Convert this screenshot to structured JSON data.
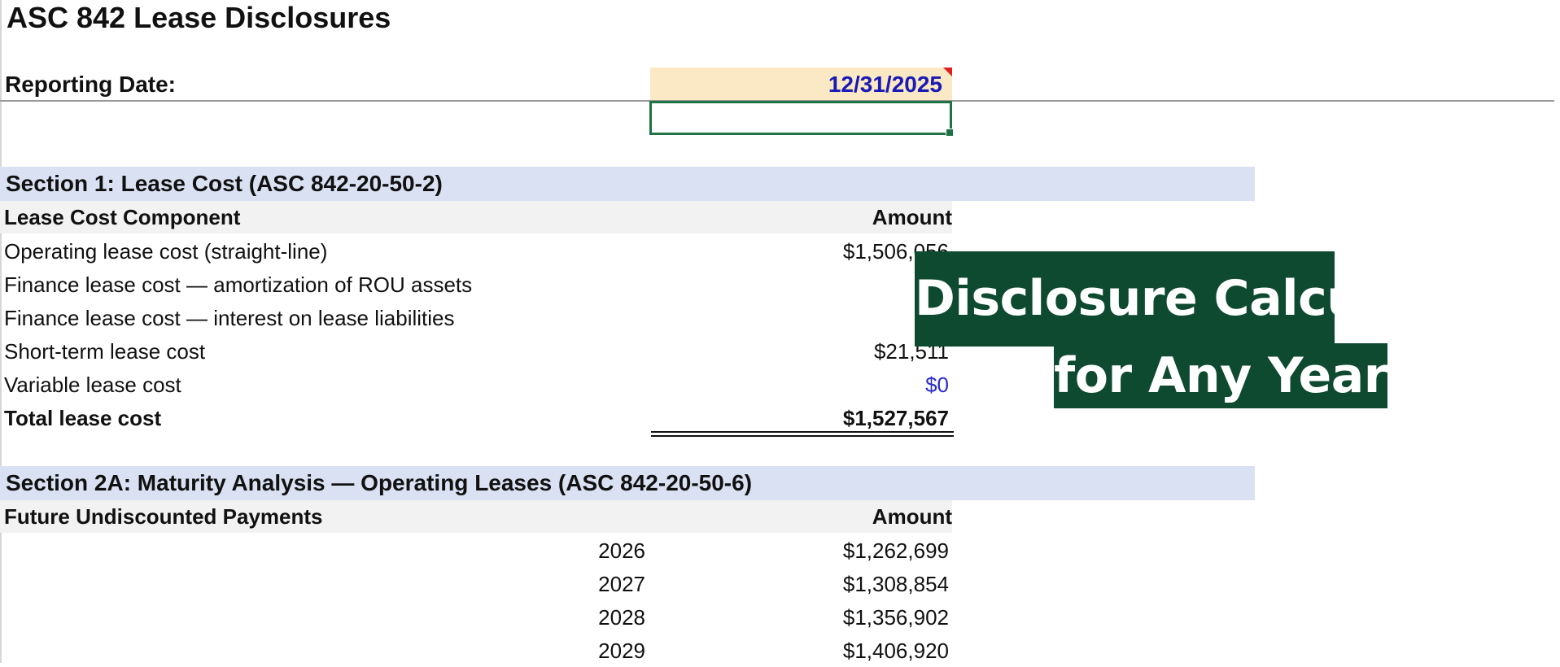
{
  "sheet": {
    "title": "ASC 842 Lease Disclosures",
    "reporting_date_label": "Reporting Date:",
    "reporting_date_value": "12/31/2025"
  },
  "section1": {
    "title": "Section 1: Lease Cost (ASC 842-20-50-2)",
    "header_component": "Lease Cost Component",
    "header_amount": "Amount",
    "rows": [
      {
        "label": "Operating lease cost (straight-line)",
        "value": "$1,506,056"
      },
      {
        "label": "Finance lease cost — amortization of ROU assets",
        "value": ""
      },
      {
        "label": "Finance lease cost — interest on lease liabilities",
        "value": ""
      },
      {
        "label": "Short-term lease cost",
        "value": "$21,511"
      },
      {
        "label": "Variable lease cost",
        "value": "$0"
      }
    ],
    "total_label": "Total lease cost",
    "total_value": "$1,527,567"
  },
  "section2a": {
    "title": "Section 2A: Maturity Analysis — Operating Leases (ASC 842-20-50-6)",
    "header_payments": "Future Undiscounted Payments",
    "header_amount": "Amount",
    "rows": [
      {
        "year": "2026",
        "value": "$1,262,699"
      },
      {
        "year": "2027",
        "value": "$1,308,854"
      },
      {
        "year": "2028",
        "value": "$1,356,902"
      },
      {
        "year": "2029",
        "value": "$1,406,920"
      }
    ]
  },
  "overlay": {
    "line1": "Disclosure Calculations",
    "line2": "for Any Year"
  },
  "colors": {
    "section_band": "#d9e1f2",
    "header_band": "#f2f2f2",
    "input_cell": "#fbe8c4",
    "input_text": "#1a1ab4",
    "selection": "#1f7244",
    "overlay_bg": "#0e4a30"
  }
}
